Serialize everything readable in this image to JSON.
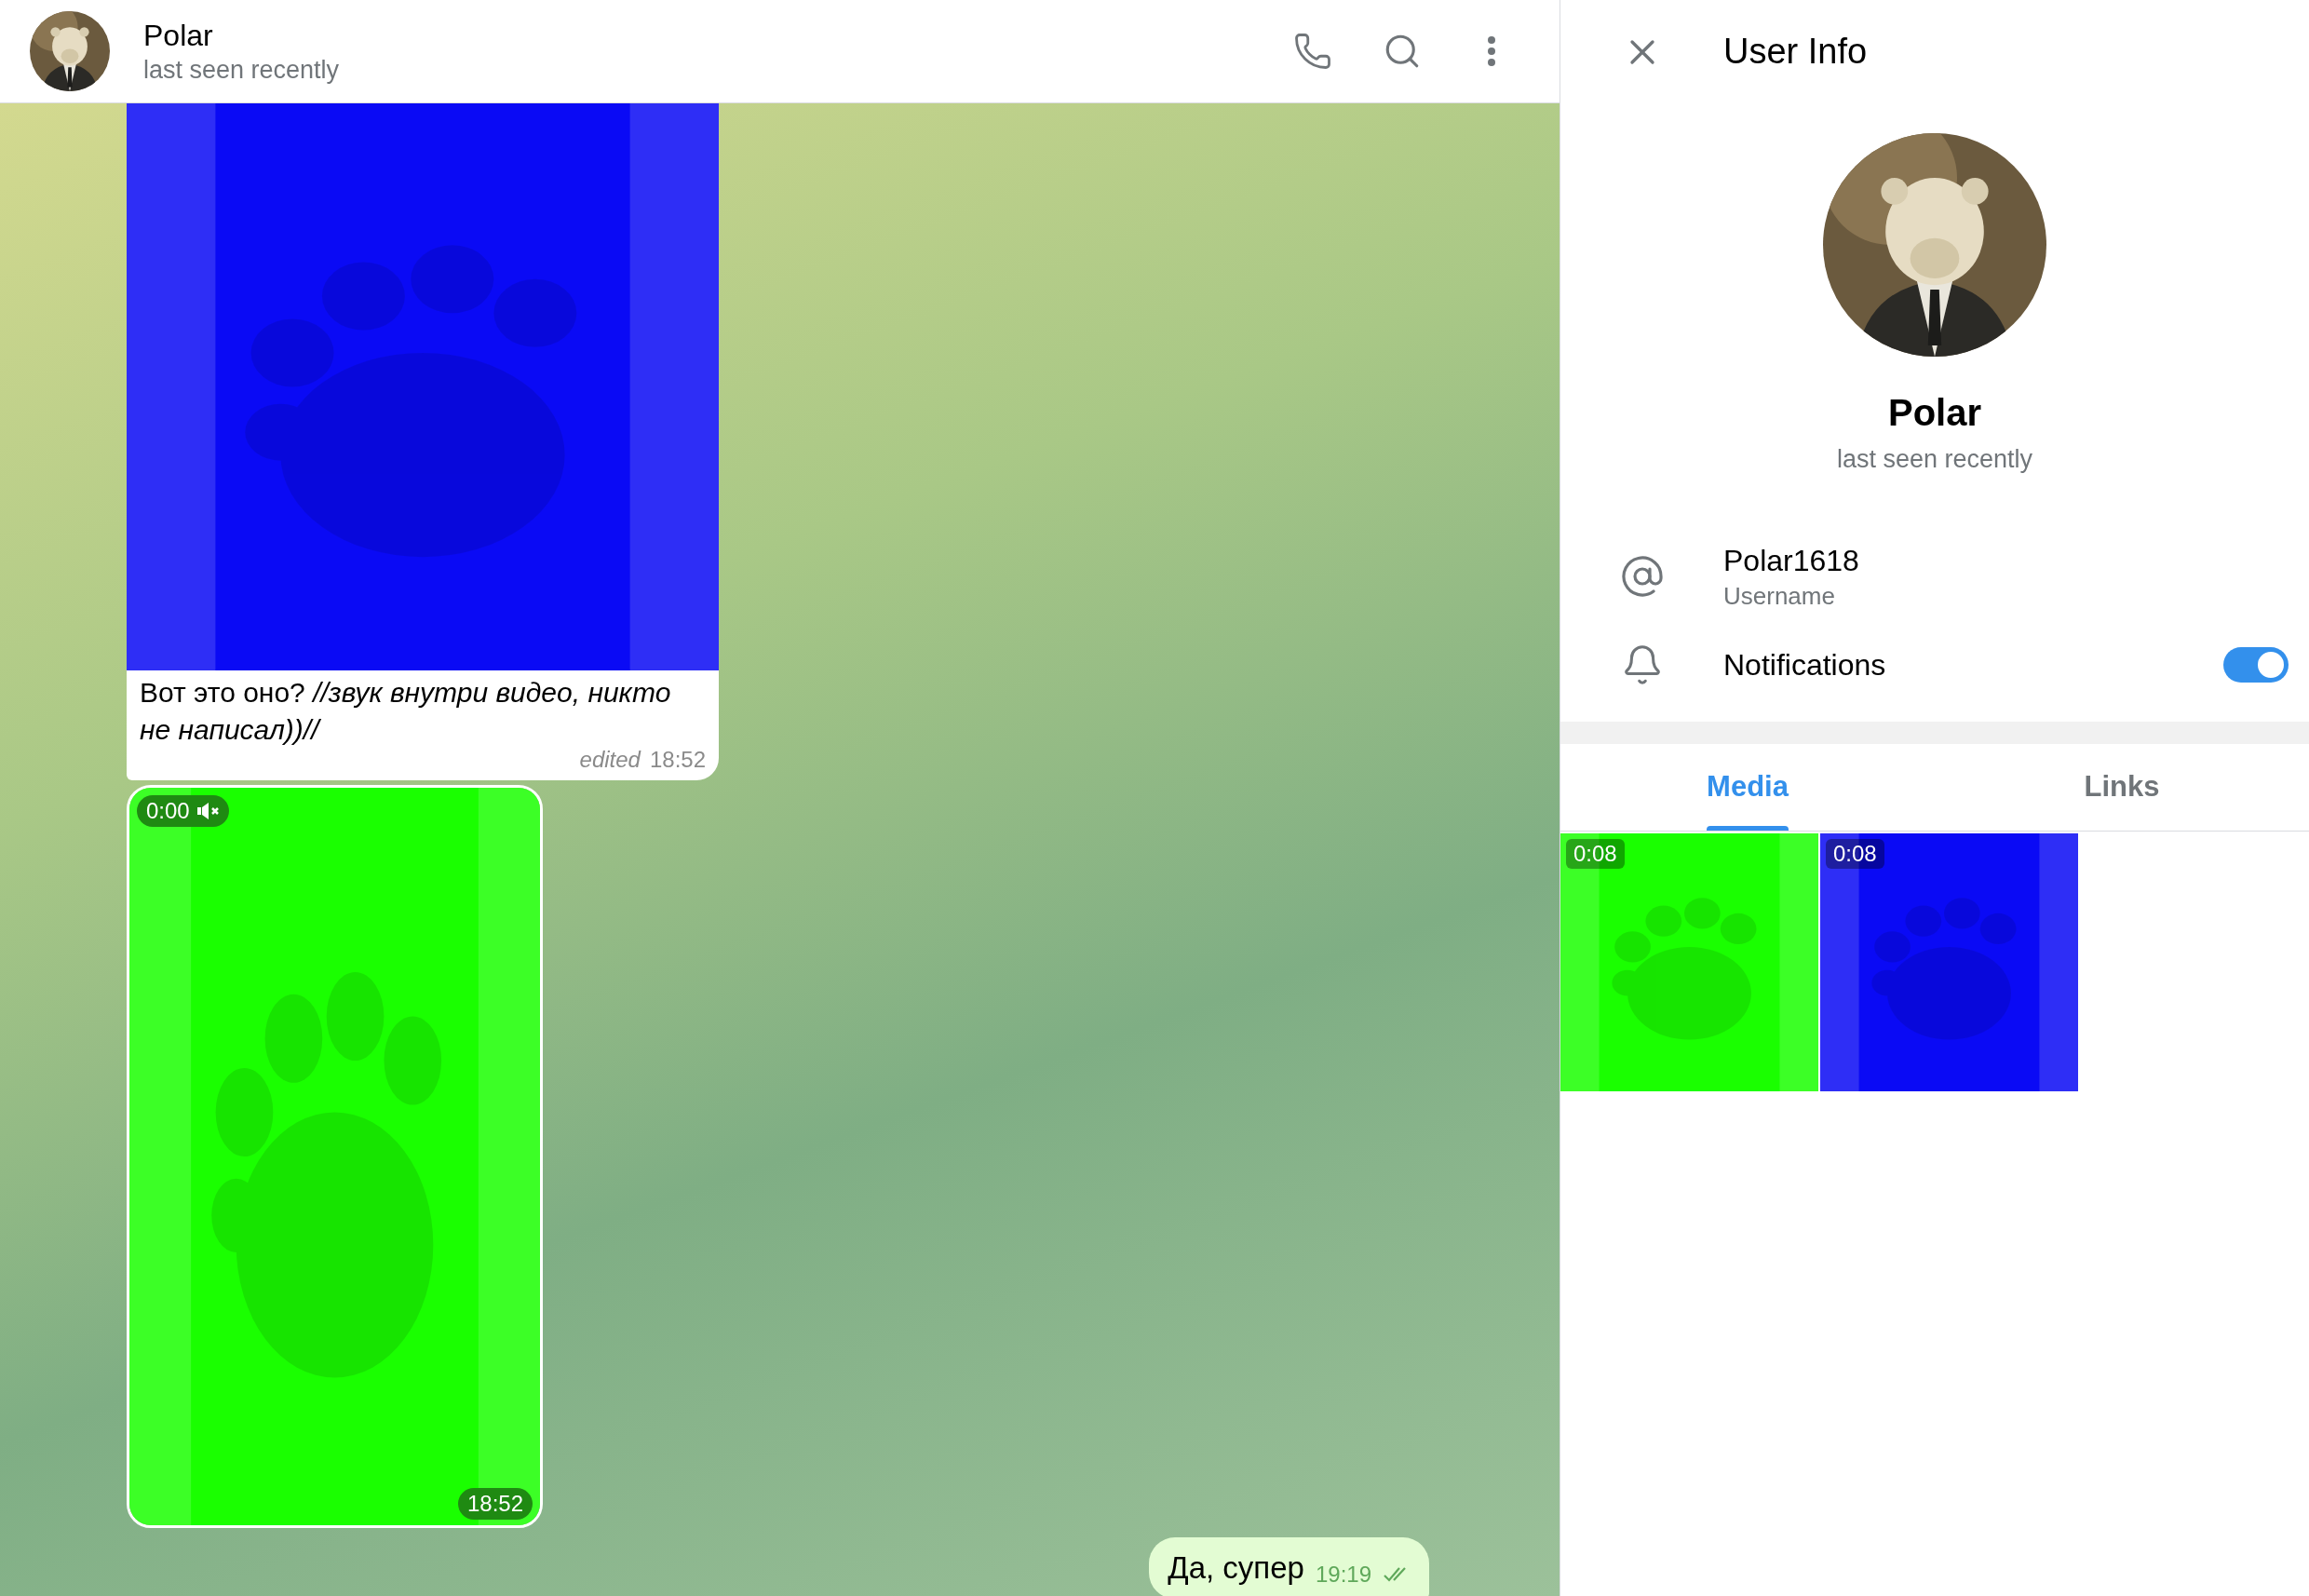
{
  "chat_header": {
    "name": "Polar",
    "status": "last seen recently"
  },
  "messages": [
    {
      "kind": "video",
      "color": "#0a0af5",
      "caption": "Вот это оно? *//звук внутри видео, никто не написал))//*",
      "edited": "edited",
      "time": "18:52"
    },
    {
      "kind": "video",
      "color": "#1aff00",
      "duration": "0:00",
      "muted": true,
      "time": "18:52"
    },
    {
      "kind": "text",
      "text": "Да, супер",
      "time": "19:19",
      "read": true
    }
  ],
  "user_info": {
    "title": "User Info",
    "name": "Polar",
    "status": "last seen recently",
    "rows": [
      {
        "kind": "username",
        "value": "Polar1618",
        "label": "Username"
      },
      {
        "kind": "notifications",
        "label": "Notifications",
        "on": true
      }
    ],
    "tabs": [
      {
        "label": "Media",
        "selected": true
      },
      {
        "label": "Links",
        "selected": false
      }
    ],
    "media": [
      {
        "duration": "0:08",
        "color": "#1aff00"
      },
      {
        "duration": "0:08",
        "color": "#0a0af5"
      }
    ]
  }
}
